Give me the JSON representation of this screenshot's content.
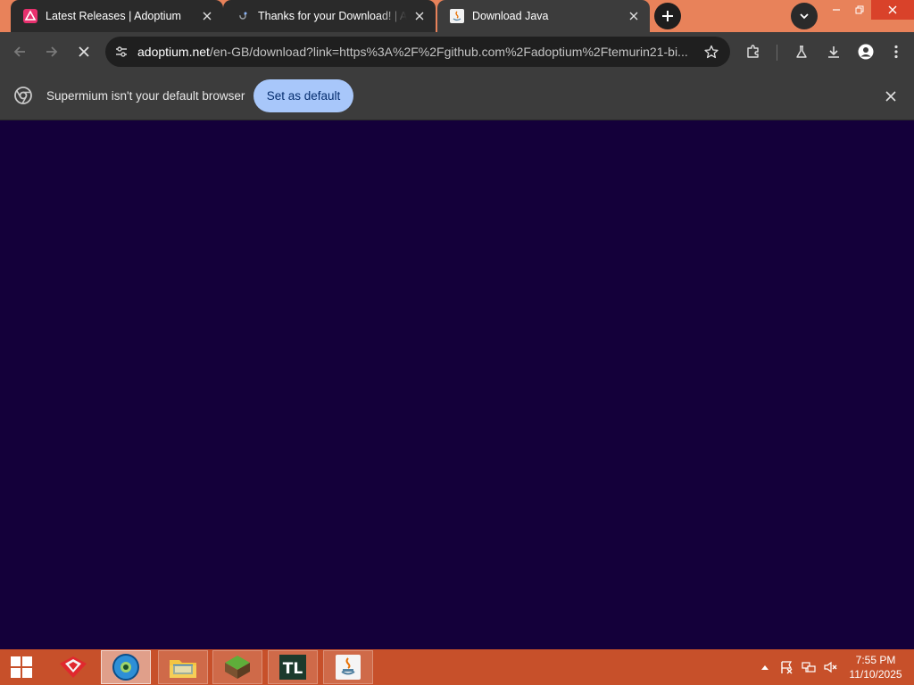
{
  "browser": {
    "tabs": [
      {
        "title": "Latest Releases | Adoptium",
        "favicon": "adoptium-icon",
        "state": "inactive"
      },
      {
        "title": "Thanks for your Download! | Ad",
        "favicon": "loading-icon",
        "state": "inactive"
      },
      {
        "title": "Download Java",
        "favicon": "java-icon",
        "state": "active"
      }
    ],
    "address_bar": {
      "host": "adoptium.net",
      "path": "/en-GB/download?link=https%3A%2F%2Fgithub.com%2Fadoptium%2Ftemurin21-bi..."
    },
    "infobar": {
      "message": "Supermium isn't your default browser",
      "button_label": "Set as default"
    }
  },
  "page": {
    "background_color": "#14003a"
  },
  "taskbar": {
    "apps": [
      {
        "name": "toolbox-app-icon"
      },
      {
        "name": "supermium-browser-icon",
        "state": "active"
      },
      {
        "name": "file-explorer-icon"
      },
      {
        "name": "minecraft-icon"
      },
      {
        "name": "tlauncher-icon",
        "label": "TL"
      },
      {
        "name": "java-app-icon"
      }
    ],
    "clock": {
      "time": "7:55 PM",
      "date": "11/10/2025"
    }
  },
  "colors": {
    "titlebar": "#e8825a",
    "toolbar": "#3c3c3c",
    "taskbar": "#c7502a",
    "accent_button": "#a8c7fa",
    "close_button": "#d9422a"
  }
}
